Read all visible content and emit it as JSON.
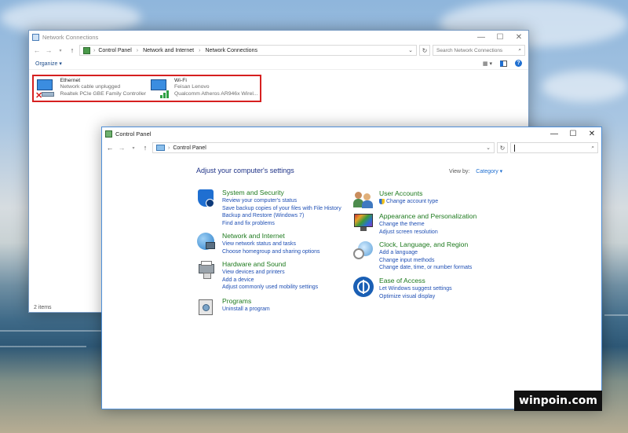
{
  "net_window": {
    "title": "Network Connections",
    "breadcrumbs": [
      "Control Panel",
      "Network and Internet",
      "Network Connections"
    ],
    "search_placeholder": "Search Network Connections",
    "organize": "Organize ▾",
    "adapters": [
      {
        "name": "Ethernet",
        "status": "Network cable unplugged",
        "device": "Realtek PCIe GBE Family Controller"
      },
      {
        "name": "Wi-Fi",
        "status": "Feisan Lenovo",
        "device": "Qualcomm Atheros AR946x Wirel..."
      }
    ],
    "status": "2 items"
  },
  "cp_window": {
    "title": "Control Panel",
    "breadcrumb": "Control Panel",
    "heading": "Adjust your computer's settings",
    "view_by_label": "View by:",
    "view_by_value": "Category ▾",
    "left_categories": [
      {
        "title": "System and Security",
        "links": [
          "Review your computer's status",
          "Save backup copies of your files with File History",
          "Backup and Restore (Windows 7)",
          "Find and fix problems"
        ]
      },
      {
        "title": "Network and Internet",
        "links": [
          "View network status and tasks",
          "Choose homegroup and sharing options"
        ]
      },
      {
        "title": "Hardware and Sound",
        "links": [
          "View devices and printers",
          "Add a device",
          "Adjust commonly used mobility settings"
        ]
      },
      {
        "title": "Programs",
        "links": [
          "Uninstall a program"
        ]
      }
    ],
    "right_categories": [
      {
        "title": "User Accounts",
        "links": [
          "Change account type"
        ]
      },
      {
        "title": "Appearance and Personalization",
        "links": [
          "Change the theme",
          "Adjust screen resolution"
        ]
      },
      {
        "title": "Clock, Language, and Region",
        "links": [
          "Add a language",
          "Change input methods",
          "Change date, time, or number formats"
        ]
      },
      {
        "title": "Ease of Access",
        "links": [
          "Let Windows suggest settings",
          "Optimize visual display"
        ]
      }
    ]
  },
  "watermark": "winpoin.com",
  "icons": {
    "minimize": "minimize-icon",
    "maximize": "maximize-icon",
    "close": "close-icon",
    "back": "back-arrow-icon",
    "forward": "forward-arrow-icon",
    "up": "up-arrow-icon",
    "refresh": "refresh-icon",
    "search": "search-icon",
    "help": "help-icon"
  }
}
